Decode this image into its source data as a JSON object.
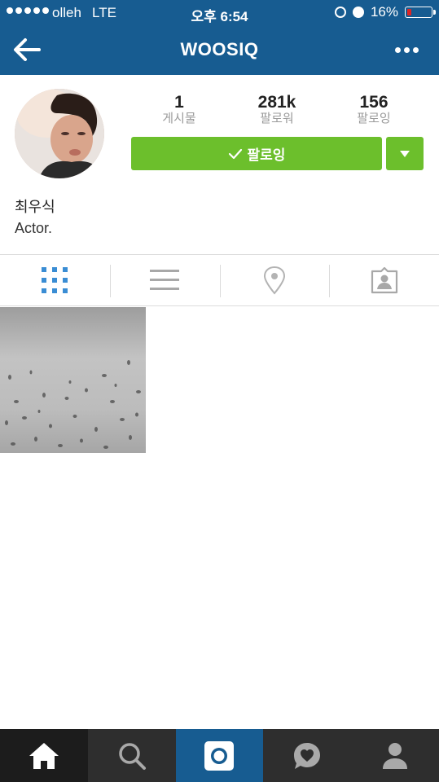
{
  "status_bar": {
    "carrier": "olleh",
    "network": "LTE",
    "time": "오후 6:54",
    "battery": "16%"
  },
  "nav": {
    "title": "WOOSIQ"
  },
  "profile": {
    "stats": [
      {
        "value": "1",
        "label": "게시물"
      },
      {
        "value": "281k",
        "label": "팔로워"
      },
      {
        "value": "156",
        "label": "팔로잉"
      }
    ],
    "follow_button_label": "팔로잉",
    "name": "최우식",
    "bio": "Actor."
  },
  "icons": {
    "back": "arrow-left-icon",
    "more": "more-dots-icon",
    "grid": "grid-icon",
    "list": "list-icon",
    "location": "location-pin-icon",
    "tagged": "tagged-person-icon",
    "home": "home-icon",
    "search": "search-icon",
    "camera": "camera-icon",
    "activity": "heart-bubble-icon",
    "profile": "person-icon"
  },
  "colors": {
    "header": "#175c91",
    "follow_green": "#6cbf2c",
    "active_tab": "#3a8dd4",
    "tabbar": "#2e2e2e"
  }
}
